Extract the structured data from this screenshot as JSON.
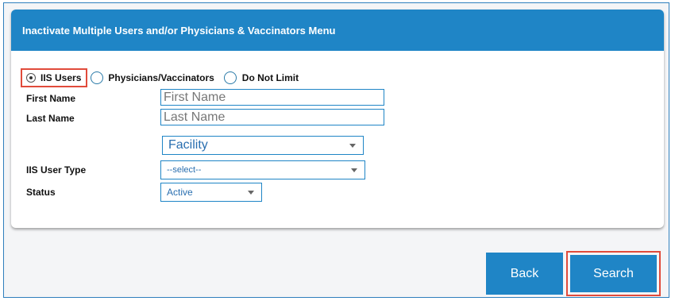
{
  "header": {
    "title": "Inactivate Multiple Users and/or Physicians & Vaccinators Menu"
  },
  "radios": [
    {
      "label": "IIS Users",
      "selected": true
    },
    {
      "label": "Physicians/Vaccinators",
      "selected": false
    },
    {
      "label": "Do Not Limit",
      "selected": false
    }
  ],
  "form": {
    "first_name_label": "First Name",
    "first_name_placeholder": "First Name",
    "first_name_value": "",
    "last_name_label": "Last Name",
    "last_name_placeholder": "Last Name",
    "last_name_value": "",
    "facility_value": "Facility",
    "user_type_label": "IIS User Type",
    "user_type_value": "--select--",
    "status_label": "Status",
    "status_value": "Active"
  },
  "buttons": {
    "back": "Back",
    "search": "Search"
  },
  "colors": {
    "primary": "#1f85c6",
    "highlight": "#e14b3b"
  },
  "icons": {
    "dropdown": "caret-down-icon"
  }
}
